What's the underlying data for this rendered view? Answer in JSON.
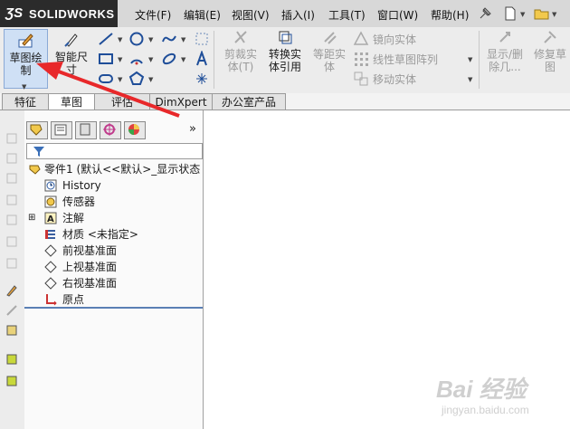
{
  "app": {
    "logo_text": "SOLIDWORKS"
  },
  "menu": [
    {
      "label": "文件(F)"
    },
    {
      "label": "编辑(E)"
    },
    {
      "label": "视图(V)"
    },
    {
      "label": "插入(I)"
    },
    {
      "label": "工具(T)"
    },
    {
      "label": "窗口(W)"
    },
    {
      "label": "帮助(H)"
    }
  ],
  "commands": {
    "sketch": "草图绘\n制",
    "smart_dim": "智能尺\n寸",
    "trim": "剪裁实\n体(T)",
    "convert": "转换实\n体引用",
    "offset": "等距实\n体",
    "mirror": "镜向实体",
    "linear_pattern": "线性草图阵列",
    "move": "移动实体",
    "show_delete": "显示/删\n除几...",
    "repair": "修复草\n图"
  },
  "tabs": [
    {
      "label": "特征",
      "active": false
    },
    {
      "label": "草图",
      "active": true
    },
    {
      "label": "评估",
      "active": false
    },
    {
      "label": "DimXpert",
      "active": false
    },
    {
      "label": "办公室产品",
      "active": false
    }
  ],
  "tree": {
    "root": "零件1 (默认<<默认>_显示状态",
    "items": [
      {
        "label": "History",
        "icon": "history-icon"
      },
      {
        "label": "传感器",
        "icon": "sensor-icon"
      },
      {
        "label": "注解",
        "icon": "annotation-icon"
      },
      {
        "label": "材质 <未指定>",
        "icon": "material-icon"
      },
      {
        "label": "前视基准面",
        "icon": "plane-icon"
      },
      {
        "label": "上视基准面",
        "icon": "plane-icon"
      },
      {
        "label": "右视基准面",
        "icon": "plane-icon"
      },
      {
        "label": "原点",
        "icon": "origin-icon"
      }
    ]
  },
  "watermark": {
    "main": "Bai 经验",
    "sub": "jingyan.baidu.com"
  },
  "colors": {
    "arrow": "#e8282a",
    "logo_bg": "#2b2b2b",
    "selection": "#cfe0f5"
  }
}
